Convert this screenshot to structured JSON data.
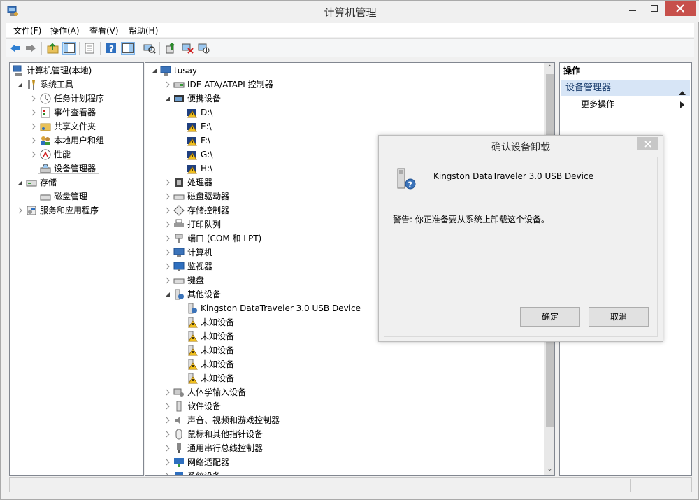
{
  "window": {
    "title": "计算机管理"
  },
  "menu": [
    "文件(F)",
    "操作(A)",
    "查看(V)",
    "帮助(H)"
  ],
  "toolbar_icons": [
    "back-icon",
    "forward-icon",
    "up-folder-icon",
    "show-tree-icon",
    "properties-icon",
    "help-icon",
    "action-pane-icon",
    "scan-hardware-icon",
    "update-driver-icon",
    "uninstall-icon",
    "disable-icon"
  ],
  "left_tree": {
    "root": "计算机管理(本地)",
    "system_tools": "系统工具",
    "task_scheduler": "任务计划程序",
    "event_viewer": "事件查看器",
    "shared_folders": "共享文件夹",
    "local_users": "本地用户和组",
    "performance": "性能",
    "device_manager": "设备管理器",
    "storage": "存储",
    "disk_mgmt": "磁盘管理",
    "services": "服务和应用程序"
  },
  "device_tree": {
    "computer": "tusay",
    "ide": "IDE ATA/ATAPI 控制器",
    "portable": "便携设备",
    "drives": [
      "D:\\",
      "E:\\",
      "F:\\",
      "G:\\",
      "H:\\"
    ],
    "processor": "处理器",
    "disk_drives": "磁盘驱动器",
    "storage_ctrl": "存储控制器",
    "print_queue": "打印队列",
    "ports": "端口 (COM 和 LPT)",
    "computer_node": "计算机",
    "monitors": "监视器",
    "keyboards": "键盘",
    "other_devices": "其他设备",
    "other_children": [
      "Kingston DataTraveler 3.0 USB Device",
      "未知设备",
      "未知设备",
      "未知设备",
      "未知设备",
      "未知设备"
    ],
    "hid": "人体学输入设备",
    "software": "软件设备",
    "sound": "声音、视频和游戏控制器",
    "mice": "鼠标和其他指针设备",
    "usb": "通用串行总线控制器",
    "network": "网络适配器",
    "system_partial": "系统设备"
  },
  "actions": {
    "header": "操作",
    "section": "设备管理器",
    "more": "更多操作"
  },
  "dialog": {
    "title": "确认设备卸载",
    "device": "Kingston DataTraveler 3.0 USB Device",
    "warning": "警告: 你正准备要从系统上卸载这个设备。",
    "ok": "确定",
    "cancel": "取消"
  },
  "colors": {
    "close": "#c7504b",
    "section_bg": "#d7e5f6",
    "accent": "#1a3d6e"
  }
}
